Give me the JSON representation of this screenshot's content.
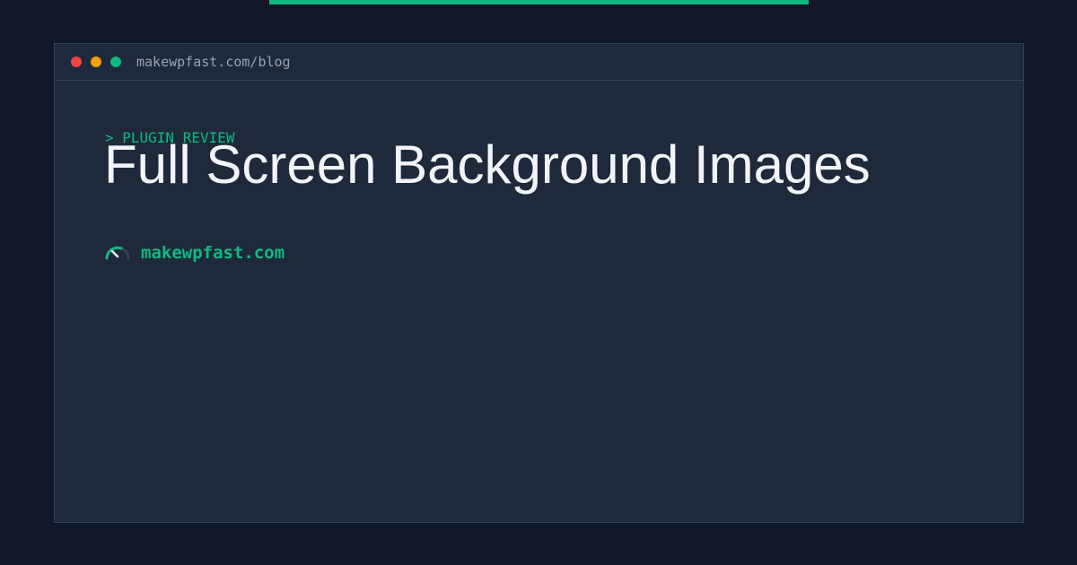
{
  "window": {
    "url": "makewpfast.com/blog"
  },
  "post": {
    "category": "> PLUGIN REVIEW",
    "title": "Full Screen Background Images"
  },
  "brand": {
    "name": "makewpfast.com",
    "icon": "speedometer-icon"
  },
  "colors": {
    "background": "#0f1729",
    "window": "#1e293b",
    "accent": "#10b981",
    "dot_red": "#ef4444",
    "dot_yellow": "#f59e0b",
    "dot_green": "#10b981",
    "url_text": "#94a3b8",
    "title_text": "#f1f5f9"
  }
}
